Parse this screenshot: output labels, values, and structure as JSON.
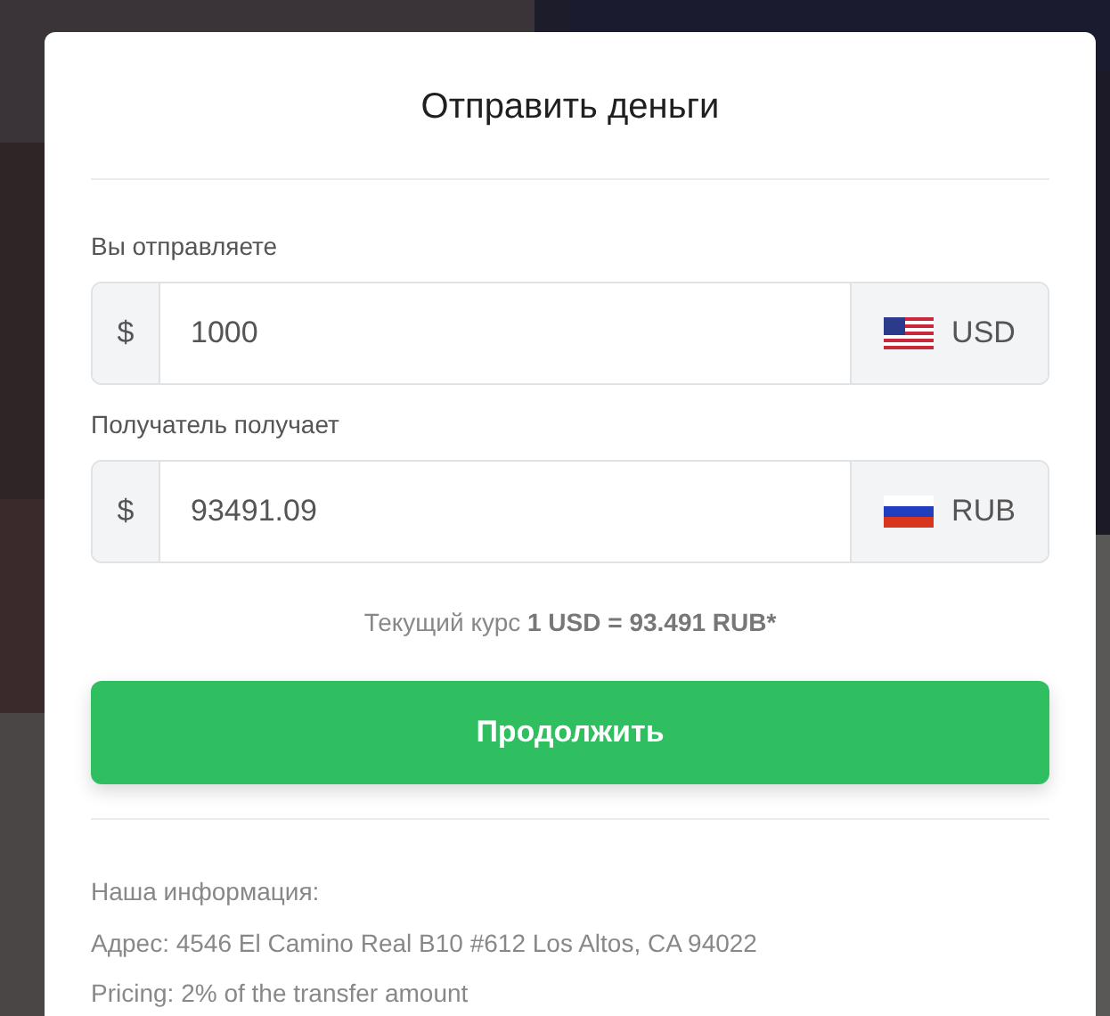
{
  "title": "Отправить деньги",
  "fields": [
    {
      "label": "Вы отправляете",
      "prefix": "$",
      "value": "1000",
      "currency": "USD",
      "kind": "us"
    },
    {
      "label": "Получатель получает",
      "prefix": "$",
      "value": "93491.09",
      "currency": "RUB",
      "kind": "ru"
    }
  ],
  "rate": {
    "label": "Текущий курс",
    "value": "1 USD = 93.491 RUB*"
  },
  "button": "Продолжить",
  "info": [
    "Наша информация:",
    "Адрес: 4546 El Camino Real B10 #612 Los Altos, CA 94022",
    "Pricing: 2% of the transfer amount"
  ]
}
